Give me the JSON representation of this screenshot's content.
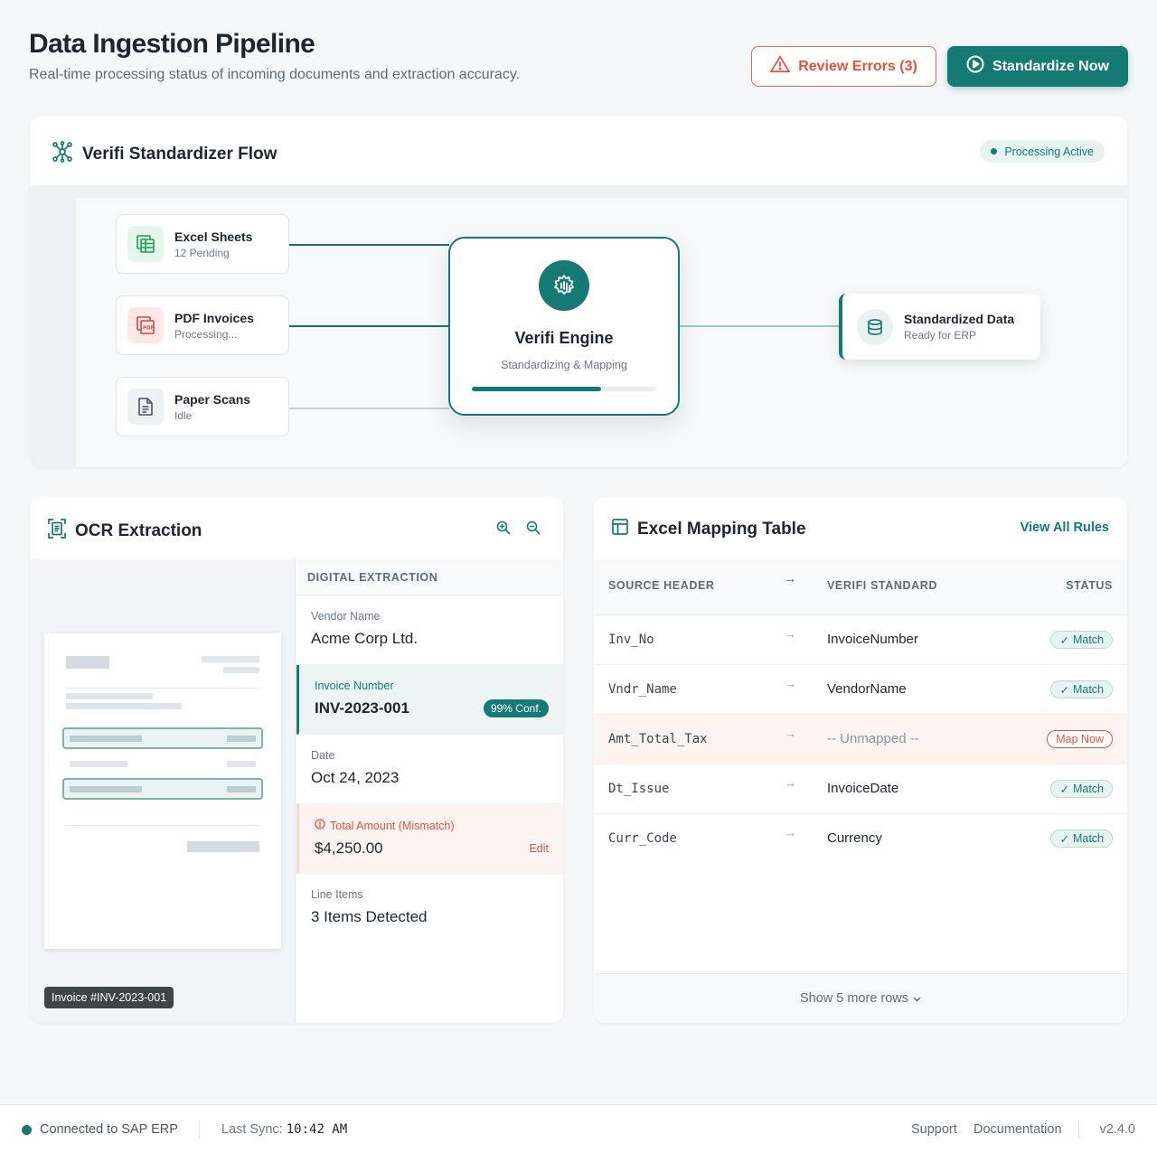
{
  "header": {
    "title": "Data Ingestion Pipeline",
    "subtitle": "Real-time processing status of incoming documents and extraction accuracy.",
    "review_label": "Review Errors (3)",
    "standardize_label": "Standardize Now"
  },
  "flow": {
    "title": "Verifi Standardizer Flow",
    "status": "Processing Active",
    "sources": [
      {
        "title": "Excel Sheets",
        "status": "12 Pending"
      },
      {
        "title": "PDF Invoices",
        "status": "Processing..."
      },
      {
        "title": "Paper Scans",
        "status": "Idle"
      }
    ],
    "engine": {
      "title": "Verifi Engine",
      "subtitle": "Standardizing & Mapping",
      "progress": 0.7
    },
    "target": {
      "title": "Standardized Data",
      "status": "Ready for ERP"
    }
  },
  "ocr": {
    "title": "OCR Extraction",
    "doc_label": "Invoice #INV-2023-001",
    "extract_header": "DIGITAL EXTRACTION",
    "fields": [
      {
        "label": "Vendor Name",
        "value": "Acme Corp Ltd."
      },
      {
        "label": "Invoice Number",
        "value": "INV-2023-001",
        "confidence": "99% Conf."
      },
      {
        "label": "Date",
        "value": "Oct 24, 2023"
      },
      {
        "label": "Total Amount (Mismatch)",
        "value": "$4,250.00",
        "action": "Edit"
      },
      {
        "label": "Line Items",
        "value": "3 Items Detected"
      }
    ]
  },
  "mapping": {
    "title": "Excel Mapping Table",
    "view_all": "View All Rules",
    "columns": {
      "source": "SOURCE HEADER",
      "arrow": "→",
      "standard": "VERIFI STANDARD",
      "status": "STATUS"
    },
    "rows": [
      {
        "source": "Inv_No",
        "arrow": "→",
        "standard": "InvoiceNumber",
        "status": "Match"
      },
      {
        "source": "Vndr_Name",
        "arrow": "→",
        "standard": "VendorName",
        "status": "Match"
      },
      {
        "source": "Amt_Total_Tax",
        "arrow": "→",
        "standard": "-- Unmapped --",
        "status": "Map Now"
      },
      {
        "source": "Dt_Issue",
        "arrow": "→",
        "standard": "InvoiceDate",
        "status": "Match"
      },
      {
        "source": "Curr_Code",
        "arrow": "→",
        "standard": "Currency",
        "status": "Match"
      }
    ],
    "show_more": "Show 5 more rows"
  },
  "footer": {
    "connection": "Connected to SAP ERP",
    "sync_label": "Last Sync:",
    "sync_time": "10:42 AM",
    "support": "Support",
    "docs": "Documentation",
    "version": "v2.4.0"
  },
  "colors": {
    "accent": "#147a73",
    "error": "#e0533f",
    "background": "#f6f7f9"
  }
}
